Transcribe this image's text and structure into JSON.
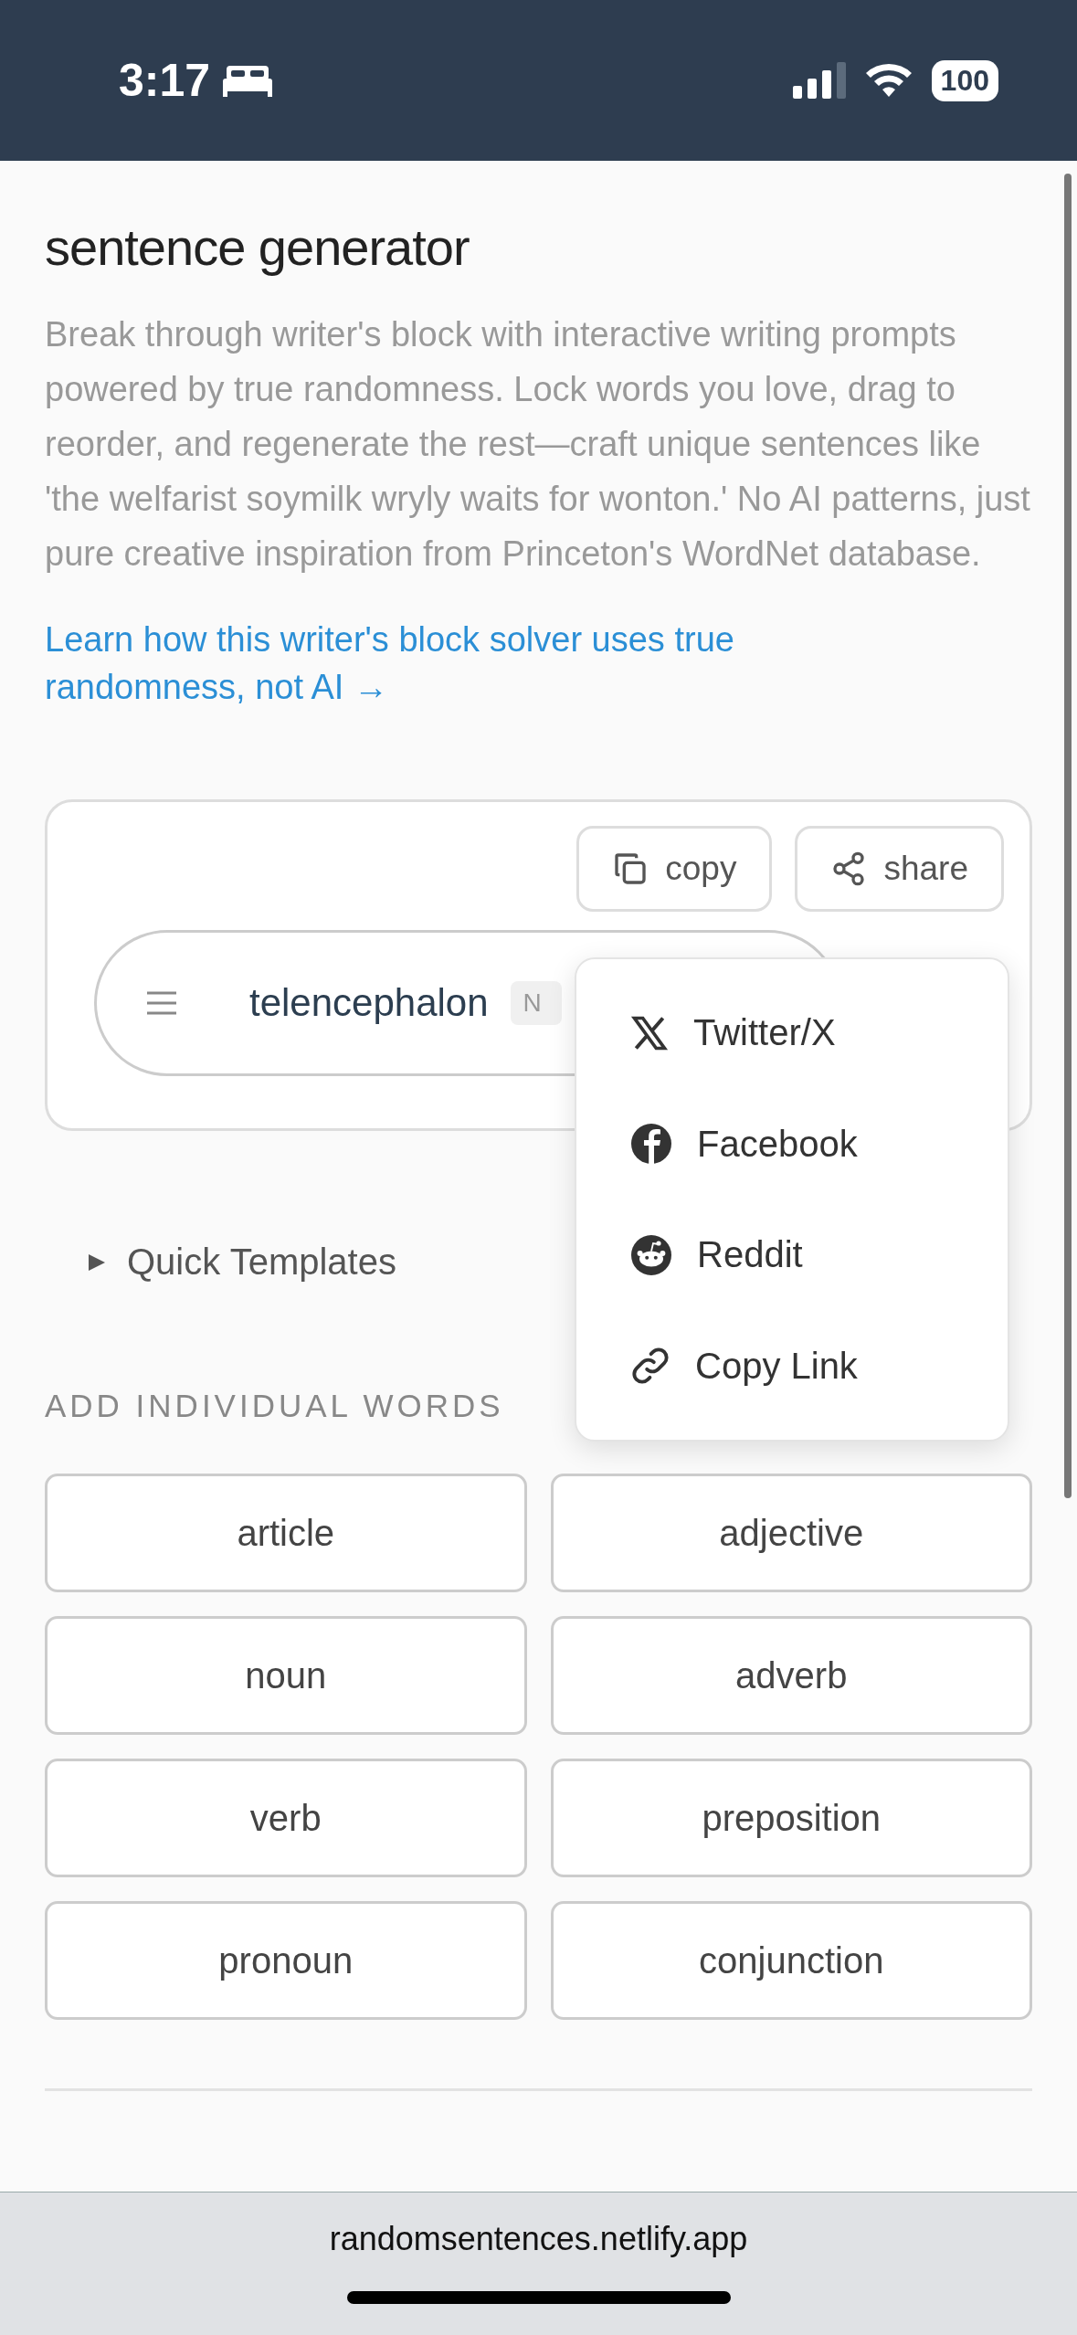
{
  "status_bar": {
    "time": "3:17",
    "battery": "100"
  },
  "header": {
    "title": "sentence generator",
    "description": "Break through writer's block with interactive writing prompts powered by true randomness. Lock words you love, drag to reorder, and regenerate the rest—craft unique sentences like 'the welfarist soymilk wryly waits for wonton.' No AI patterns, just pure creative inspiration from Princeton's WordNet database.",
    "link": "Learn how this writer's block solver uses true randomness, not AI →"
  },
  "actions": [
    {
      "label": "copy",
      "kind": "copy"
    },
    {
      "label": "share",
      "kind": "share"
    }
  ],
  "sentence": {
    "words": [
      {
        "text": "telencephalon",
        "tag": "N"
      }
    ]
  },
  "share_menu": {
    "items": [
      {
        "label": "Twitter/X",
        "kind": "x"
      },
      {
        "label": "Facebook",
        "kind": "facebook"
      },
      {
        "label": "Reddit",
        "kind": "reddit"
      },
      {
        "label": "Copy Link",
        "kind": "link"
      }
    ]
  },
  "quick_templates": {
    "label": "Quick Templates",
    "expanded": false
  },
  "add_words": {
    "heading": "ADD INDIVIDUAL WORDS",
    "buttons": [
      "article",
      "adjective",
      "noun",
      "adverb",
      "verb",
      "preposition",
      "pronoun",
      "conjunction"
    ]
  },
  "browser": {
    "url": "randomsentences.netlify.app"
  }
}
